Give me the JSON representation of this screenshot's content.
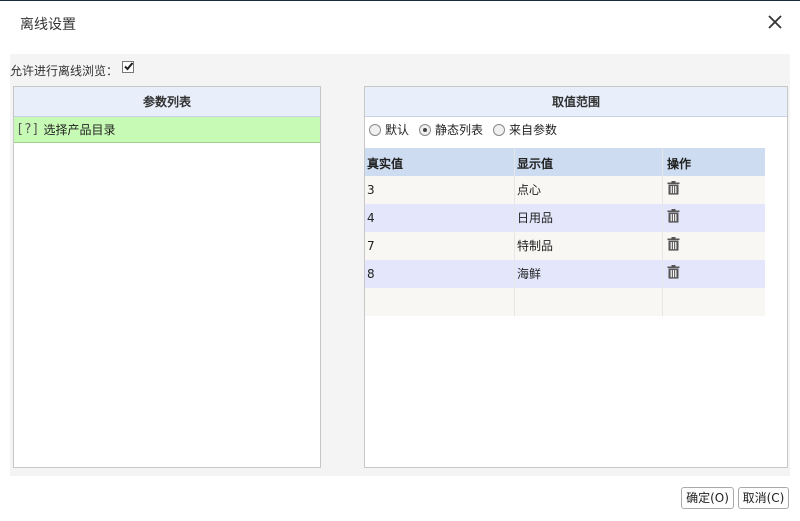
{
  "dialog": {
    "title": "离线设置"
  },
  "allow_offline": {
    "label": "允许进行离线浏览：",
    "checked": true
  },
  "param_list": {
    "header": "参数列表",
    "items": [
      {
        "icon_text": "[?]",
        "label": "选择产品目录"
      }
    ]
  },
  "value_range": {
    "header": "取值范围",
    "radios": [
      {
        "label": "默认",
        "checked": false
      },
      {
        "label": "静态列表",
        "checked": true
      },
      {
        "label": "来自参数",
        "checked": false
      }
    ],
    "table": {
      "columns": [
        "真实值",
        "显示值",
        "操作"
      ],
      "rows": [
        {
          "real": "3",
          "display": "点心"
        },
        {
          "real": "4",
          "display": "日用品"
        },
        {
          "real": "7",
          "display": "特制品"
        },
        {
          "real": "8",
          "display": "海鲜"
        }
      ]
    }
  },
  "footer": {
    "ok_label": "确定(O)",
    "cancel_label": "取消(C)"
  }
}
